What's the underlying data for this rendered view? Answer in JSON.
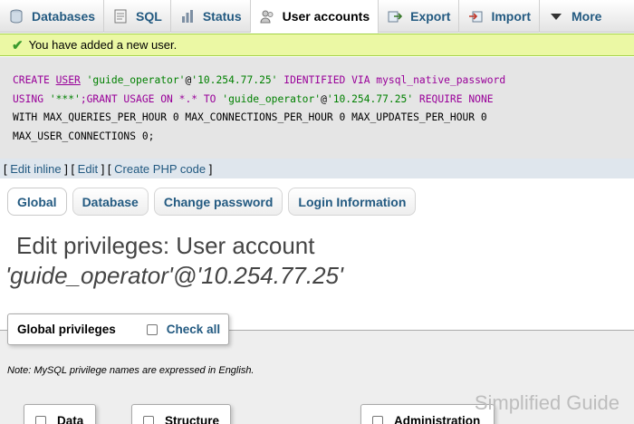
{
  "tabs": [
    {
      "label": "Databases",
      "icon": "database-icon"
    },
    {
      "label": "SQL",
      "icon": "sql-icon"
    },
    {
      "label": "Status",
      "icon": "status-icon"
    },
    {
      "label": "User accounts",
      "icon": "users-icon"
    },
    {
      "label": "Export",
      "icon": "export-icon"
    },
    {
      "label": "Import",
      "icon": "import-icon"
    },
    {
      "label": "More",
      "icon": "caret-down-icon"
    }
  ],
  "message": {
    "text": "You have added a new user."
  },
  "sql": {
    "line1_a": "CREATE ",
    "line1_b": "USER",
    "line1_c": " 'guide_operator'",
    "line1_d": "@",
    "line1_e": "'10.254.77.25'",
    "line1_f": " IDENTIFIED VIA mysql_native_password",
    "line2_a": "USING ",
    "line2_b": "'***'",
    "line2_c": ";GRANT USAGE ON *.* TO ",
    "line2_d": "'guide_operator'",
    "line2_e": "@",
    "line2_f": "'10.254.77.25'",
    "line2_g": " REQUIRE NONE",
    "line3": "WITH MAX_QUERIES_PER_HOUR 0 MAX_CONNECTIONS_PER_HOUR 0 MAX_UPDATES_PER_HOUR 0",
    "line4": "MAX_USER_CONNECTIONS 0;"
  },
  "edit_links": {
    "edit_inline": "Edit inline",
    "edit": "Edit",
    "create_php": "Create PHP code"
  },
  "subtabs": [
    "Global",
    "Database",
    "Change password",
    "Login Information"
  ],
  "heading": "Edit privileges: User account",
  "account": "'guide_operator'@'10.254.77.25'",
  "privileges": {
    "legend": "Global privileges",
    "check_all": "Check all",
    "note": "Note: MySQL privilege names are expressed in English.",
    "groups": [
      "Data",
      "Structure",
      "Administration"
    ]
  },
  "watermark": "Simplified Guide"
}
